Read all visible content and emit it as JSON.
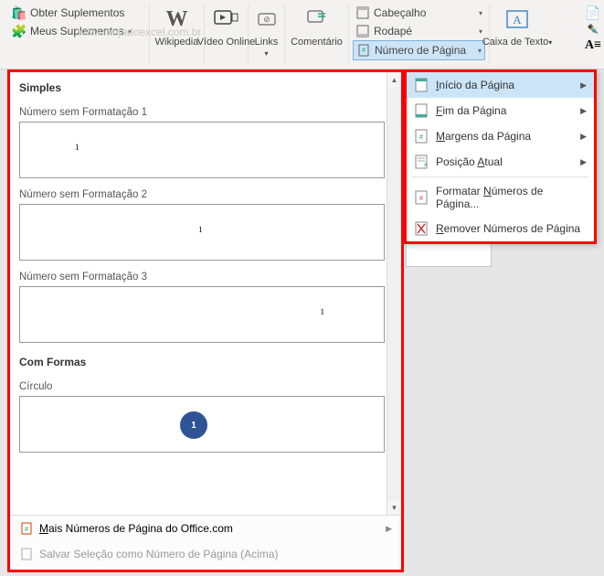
{
  "watermark": "www.ninjadoexcel.com.br",
  "ribbon": {
    "obter": "Obter Suplementos",
    "meus": "Meus Suplementos",
    "wikipedia": "Wikipedia",
    "video": "Vídeo Online",
    "links": "Links",
    "comentario": "Comentário",
    "cabecalho": "Cabeçalho",
    "rodape": "Rodapé",
    "numero_pagina": "Número de Página",
    "caixa_texto": "Caixa de Texto"
  },
  "gallery": {
    "section_simples": "Simples",
    "fmt1": "Número sem Formatação 1",
    "fmt2": "Número sem Formatação 2",
    "fmt3": "Número sem Formatação 3",
    "section_formas": "Com Formas",
    "circulo": "Círculo",
    "page_num": "1",
    "mais_office": "Mais Números de Página do Office.com",
    "salvar_sel": "Salvar Seleção como Número de Página (Acima)"
  },
  "menu": {
    "inicio": "Início da Página",
    "fim": "Fim da Página",
    "margens": "Margens da Página",
    "posicao": "Posição Atual",
    "formatar": "Formatar Números de Página...",
    "remover": "Remover Números de Página"
  }
}
